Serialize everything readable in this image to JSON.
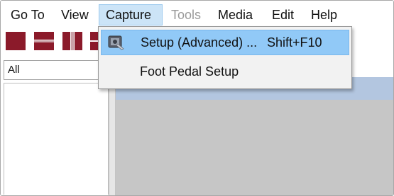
{
  "menubar": {
    "items": [
      {
        "label": "Go To",
        "state": "normal"
      },
      {
        "label": "View",
        "state": "normal"
      },
      {
        "label": "Capture",
        "state": "open"
      },
      {
        "label": "Tools",
        "state": "disabled"
      },
      {
        "label": "Media",
        "state": "normal"
      },
      {
        "label": "Edit",
        "state": "normal"
      },
      {
        "label": "Help",
        "state": "normal"
      }
    ]
  },
  "toolbar": {
    "icons": [
      "layout-full-icon",
      "layout-split-horizontal-icon",
      "layout-split-vertical-icon",
      "layout-partial-icon"
    ]
  },
  "left_panel": {
    "filter_value": "All"
  },
  "capture_menu": {
    "items": [
      {
        "label": "Setup (Advanced) ...",
        "shortcut": "Shift+F10",
        "icon": "capture-setup-icon",
        "highlighted": true
      },
      {
        "label": "Foot Pedal Setup",
        "shortcut": "",
        "icon": "",
        "highlighted": false
      }
    ]
  },
  "colors": {
    "toolbar_icon_red": "#8b1a2a",
    "menu_open_bg": "#cce4f7",
    "item_highlight_bg": "#91c9f7",
    "content_header": "#b3c6e0",
    "content_bg": "#c6c6c6"
  }
}
